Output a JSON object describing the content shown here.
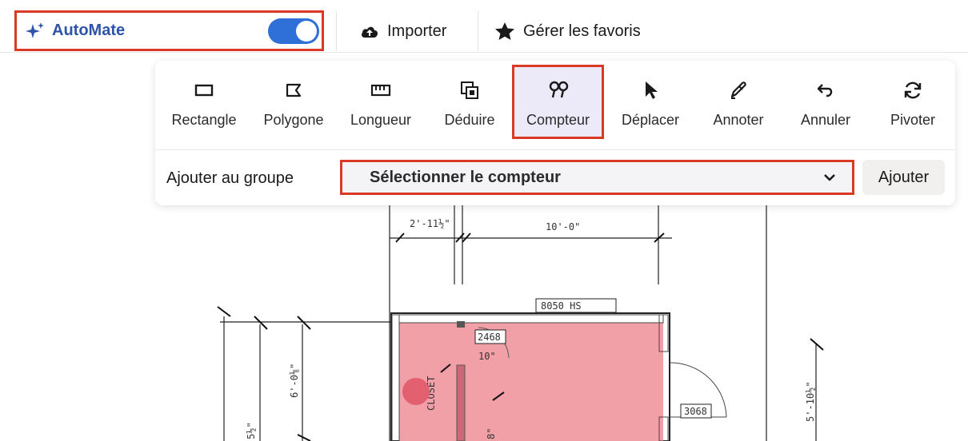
{
  "topbar": {
    "automate_label": "AutoMate",
    "automate_enabled": true,
    "import_label": "Importer",
    "favorites_label": "Gérer les favoris"
  },
  "toolbar": {
    "tools": [
      {
        "label": "Rectangle",
        "icon": "rectangle-icon"
      },
      {
        "label": "Polygone",
        "icon": "polygon-icon"
      },
      {
        "label": "Longueur",
        "icon": "ruler-icon"
      },
      {
        "label": "Déduire",
        "icon": "deduct-icon"
      },
      {
        "label": "Compteur",
        "icon": "counter-icon",
        "active": true
      },
      {
        "label": "Déplacer",
        "icon": "cursor-icon"
      },
      {
        "label": "Annoter",
        "icon": "pen-icon"
      },
      {
        "label": "Annuler",
        "icon": "undo-icon"
      },
      {
        "label": "Pivoter",
        "icon": "rotate-icon"
      }
    ]
  },
  "group": {
    "label": "Ajouter au groupe",
    "select_value": "Sélectionner le compteur",
    "add_label": "Ajouter"
  },
  "plan": {
    "dim_top_left": "2'-11½\"",
    "dim_top_right": "10'-0\"",
    "window_label": "8050 HS",
    "door_label_1": "2468",
    "dim_inner": "10\"",
    "room_label": "CLOSET",
    "dim_left": "6'-0⅛\"",
    "door_label_2": "3068",
    "dim_right": "5'-10½\"",
    "dim_far_left": "5½\"",
    "dim_small": "8\""
  },
  "colors": {
    "accent_red": "#d93a26",
    "brand_blue": "#2e54a8",
    "toggle_blue": "#2f6fd8",
    "room_fill": "#f2a0a8"
  }
}
